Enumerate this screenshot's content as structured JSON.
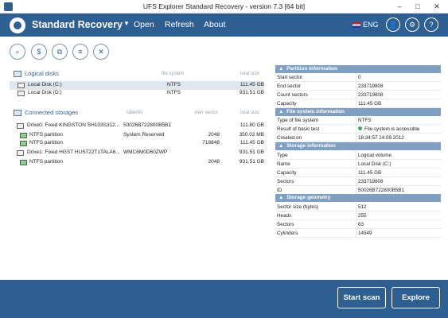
{
  "window": {
    "title": "UFS Explorer Standard Recovery - version 7.3 [64 bit]",
    "minimize": "–",
    "maximize": "□",
    "close": "✕"
  },
  "menubar": {
    "brand": "Standard Recovery",
    "arrow": "▼",
    "items": [
      "Open",
      "Refresh",
      "About"
    ],
    "language": "ENG",
    "user_glyph": "👤",
    "settings_glyph": "⚙",
    "help_glyph": "?"
  },
  "toolbar": {
    "glyphs": [
      "⌕",
      "$",
      "⧉",
      "≡",
      "✕"
    ]
  },
  "logical_disks": {
    "title": "Logical disks",
    "col_fs": "file system",
    "col_size": "total size",
    "rows": [
      {
        "name": "Local Disk (C:)",
        "fs": "NTFS",
        "size": "111.45 GB"
      },
      {
        "name": "Local Disk (D:)",
        "fs": "NTFS",
        "size": "931.51 GB"
      }
    ]
  },
  "storages": {
    "title": "Connected storages",
    "col_label": "label/ID",
    "col_start": "start sector",
    "col_size": "total size",
    "drive0": {
      "name": "Drive0: Fixed KINGSTON SH103S312...",
      "label": "50026B722800B5B1",
      "size": "111.80 GB"
    },
    "drive0_parts": [
      {
        "name": "NTFS partition",
        "label": "System Reserved",
        "start": "2048",
        "size": "350.02 MB"
      },
      {
        "name": "NTFS partition",
        "label": "",
        "start": "718848",
        "size": "111.45 GB"
      }
    ],
    "drive1": {
      "name": "Drive1: Fixed HGST HUS722T1TALA6...",
      "label": "WMC6M0D60ZWP",
      "size": "931.51 GB"
    },
    "drive1_parts": [
      {
        "name": "NTFS partition",
        "label": "",
        "start": "2048",
        "size": "931.51 GB"
      }
    ]
  },
  "info": {
    "arrow": "▲",
    "partition": {
      "title": "Partition information",
      "rows": [
        {
          "k": "Start sector",
          "v": "0"
        },
        {
          "k": "End sector",
          "v": "233719808"
        },
        {
          "k": "Count sectors",
          "v": "233719808"
        },
        {
          "k": "Capacity",
          "v": "111.45 GB"
        }
      ]
    },
    "filesystem": {
      "title": "File system information",
      "rows": [
        {
          "k": "Type of file system",
          "v": "NTFS"
        },
        {
          "k": "Result of basic test",
          "v": "File system is accessible"
        },
        {
          "k": "Created on",
          "v": "18:34:57 24.09.2012"
        }
      ]
    },
    "storage": {
      "title": "Storage information",
      "rows": [
        {
          "k": "Type",
          "v": "Logical volume"
        },
        {
          "k": "Name",
          "v": "Local Disk (C:)"
        },
        {
          "k": "Capacity",
          "v": "111.45 GB"
        },
        {
          "k": "Sectors",
          "v": "233719808"
        },
        {
          "k": "ID",
          "v": "50026B722800B5B1"
        }
      ]
    },
    "geometry": {
      "title": "Storage geometry",
      "rows": [
        {
          "k": "Sector size (bytes)",
          "v": "512"
        },
        {
          "k": "Heads",
          "v": "255"
        },
        {
          "k": "Sectors",
          "v": "63"
        },
        {
          "k": "Cylinders",
          "v": "14549"
        }
      ]
    }
  },
  "footer": {
    "start_scan": "Start scan",
    "explore": "Explore"
  },
  "colors": {
    "brand_blue": "#2e5f93",
    "section_header": "#7fa0c3",
    "selected_row": "#dfe6ee",
    "status_ok": "#3aa55a"
  }
}
